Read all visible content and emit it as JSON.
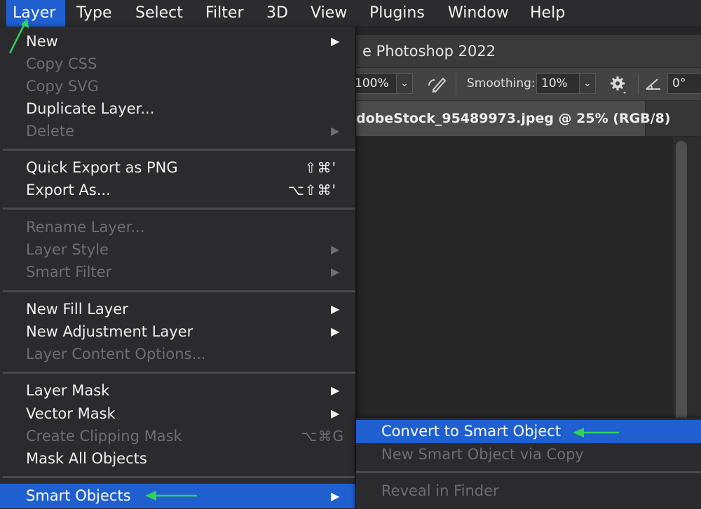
{
  "menubar": {
    "items": [
      "Layer",
      "Type",
      "Select",
      "Filter",
      "3D",
      "View",
      "Plugins",
      "Window",
      "Help"
    ],
    "active": "Layer"
  },
  "app": {
    "title": "e Photoshop 2022",
    "options": {
      "flow_value": "100%",
      "smoothing_label": "Smoothing:",
      "smoothing_value": "10%",
      "angle_value": "0°"
    },
    "document_tab": "dobeStock_95489973.jpeg @ 25% (RGB/8)"
  },
  "layer_menu": {
    "new": "New",
    "copy_css": "Copy CSS",
    "copy_svg": "Copy SVG",
    "duplicate_layer": "Duplicate Layer...",
    "delete": "Delete",
    "quick_export": "Quick Export as PNG",
    "quick_export_shortcut": "⇧⌘'",
    "export_as": "Export As...",
    "export_as_shortcut": "⌥⇧⌘'",
    "rename_layer": "Rename Layer...",
    "layer_style": "Layer Style",
    "smart_filter": "Smart Filter",
    "new_fill_layer": "New Fill Layer",
    "new_adjustment_layer": "New Adjustment Layer",
    "layer_content_options": "Layer Content Options...",
    "layer_mask": "Layer Mask",
    "vector_mask": "Vector Mask",
    "create_clipping_mask": "Create Clipping Mask",
    "create_clipping_mask_shortcut": "⌥⌘G",
    "mask_all_objects": "Mask All Objects",
    "smart_objects": "Smart Objects",
    "submenu_arrow": "▶"
  },
  "smart_objects_submenu": {
    "convert": "Convert to Smart Object",
    "new_via_copy": "New Smart Object via Copy",
    "reveal": "Reveal in Finder"
  },
  "colors": {
    "highlight": "#1f5fd0",
    "annotation_arrow": "#2fd35a"
  }
}
